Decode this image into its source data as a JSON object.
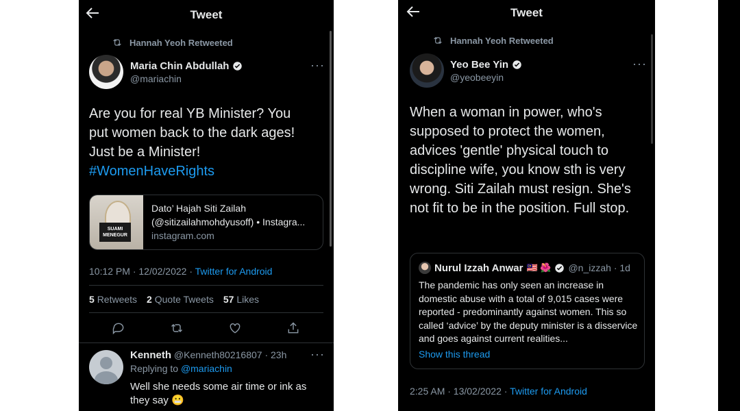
{
  "left": {
    "header_title": "Tweet",
    "retweet_label": "Hannah Yeoh Retweeted",
    "author": {
      "name": "Maria Chin Abdullah",
      "handle": "@mariachin"
    },
    "more": "···",
    "body_text": "Are you for real YB Minister? You put women back to the dark ages! Just be a Minister!",
    "hashtag": "#WomenHaveRights",
    "link_card": {
      "thumb_caption_1": "SUAMI",
      "thumb_caption_2": "MENEGUR",
      "title": "Dato’ Hajah Siti Zailah",
      "subtitle": "(@sitizailahmohdyusoff) • Instagra...",
      "domain": "instagram.com"
    },
    "timestamp": "10:12 PM · 12/02/2022 · ",
    "source": "Twitter for Android",
    "stats": {
      "retweets_count": "5",
      "retweets_label": "Retweets",
      "quotes_count": "2",
      "quotes_label": "Quote Tweets",
      "likes_count": "57",
      "likes_label": "Likes"
    },
    "reply": {
      "name": "Kenneth",
      "handle_time": "@Kenneth80216807 · 23h",
      "replying_label": "Replying to ",
      "replying_handle": "@mariachin",
      "text": "Well she needs some air time or ink as they say 😬"
    }
  },
  "right": {
    "header_title": "Tweet",
    "retweet_label": "Hannah Yeoh Retweeted",
    "author": {
      "name": "Yeo Bee Yin",
      "handle": "@yeobeeyin"
    },
    "more": "···",
    "body_text": "When a woman in power, who's supposed to protect the women, advices 'gentle' physical touch to discipline wife, you know sth is very wrong. Siti Zailah must resign. She's not fit to be in the position. Full stop.",
    "quote": {
      "name": "Nurul Izzah Anwar",
      "emoji": "🇲🇾 🌺",
      "handle_time": "@n_izzah · 1d",
      "text": "The pandemic has only seen an increase in domestic abuse with a total of 9,015 cases were reported - predominantly against women. This so called ‘advice’ by the deputy minister is a disservice and goes against current realities...",
      "link": "Show this thread"
    },
    "timestamp": "2:25 AM · 13/02/2022 · ",
    "source": "Twitter for Android"
  },
  "colors": {
    "background": "#000000",
    "text": "#e7e9ea",
    "muted": "#8b98a5",
    "accent": "#1d9bf0",
    "divider": "#2f3336"
  },
  "icons": [
    "back-arrow-icon",
    "retweet-icon",
    "verified-badge-icon",
    "reply-icon",
    "like-icon",
    "share-icon"
  ]
}
